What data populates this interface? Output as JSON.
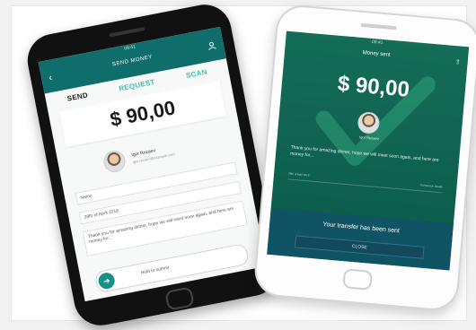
{
  "left_phone": {
    "status_time": "09:41",
    "status_battery": "100%",
    "header_title": "SEND MONEY",
    "tabs": [
      "SEND",
      "REQUEST",
      "SCAN"
    ],
    "amount": "$ 90,00",
    "recipient_name": "Igor Rezaev",
    "recipient_detail": "igor.rezaev@example.com",
    "field_name": "Name",
    "field_date": "28th of April 2018",
    "message": "Thank you for amazing dinner, hope we will meet soon again, and here are money for...",
    "request_button": "Hold to submit"
  },
  "right_phone": {
    "status_time": "09:41",
    "title": "Money sent",
    "amount": "$ 90,00",
    "recipient_name": "Igor Rezaev",
    "message": "Thank you for amazing dinner, hope we will meet soon again, and here are money for...",
    "foot_left": "28th of April 2018",
    "foot_right": "Transaction details",
    "banner_text": "Your transfer has been sent",
    "banner_button": "CLOSE"
  },
  "colors": {
    "accent_teal": "#0f6d6c",
    "tab_active": "#3fc0b2",
    "success_green": "#146d56"
  },
  "icons": [
    "back-arrow-icon",
    "user-icon",
    "arrow-right-icon",
    "check-icon",
    "share-icon"
  ]
}
